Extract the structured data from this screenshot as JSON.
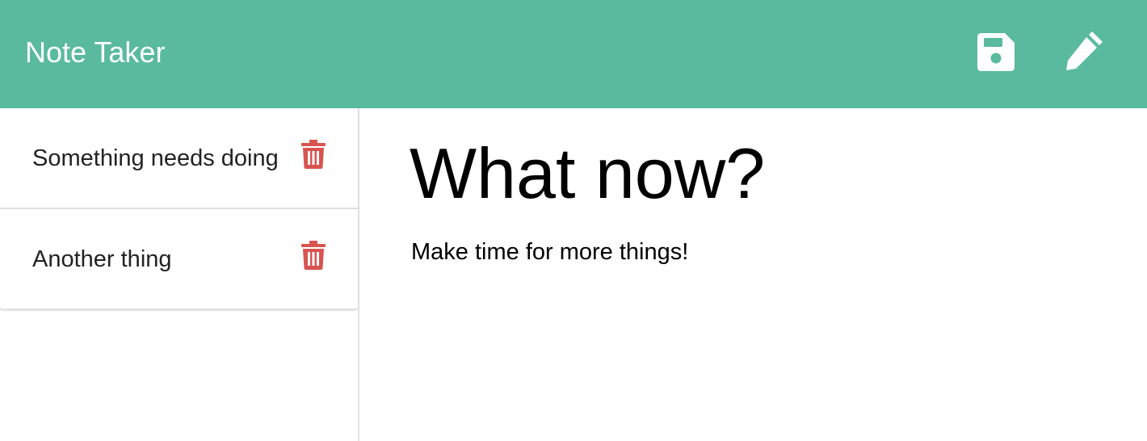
{
  "navbar": {
    "brand": "Note Taker",
    "background_color": "#5aba9e",
    "actions": [
      {
        "name": "save",
        "icon": "floppy-disk-icon"
      },
      {
        "name": "new-note",
        "icon": "pencil-icon"
      }
    ]
  },
  "sidebar": {
    "notes": [
      {
        "title": "Something needs doing",
        "delete_icon": "trash-icon"
      },
      {
        "title": "Another thing",
        "delete_icon": "trash-icon"
      }
    ],
    "delete_color": "#d9534f"
  },
  "editor": {
    "title_value": "What now?",
    "text_value": "Make time for more things!"
  }
}
